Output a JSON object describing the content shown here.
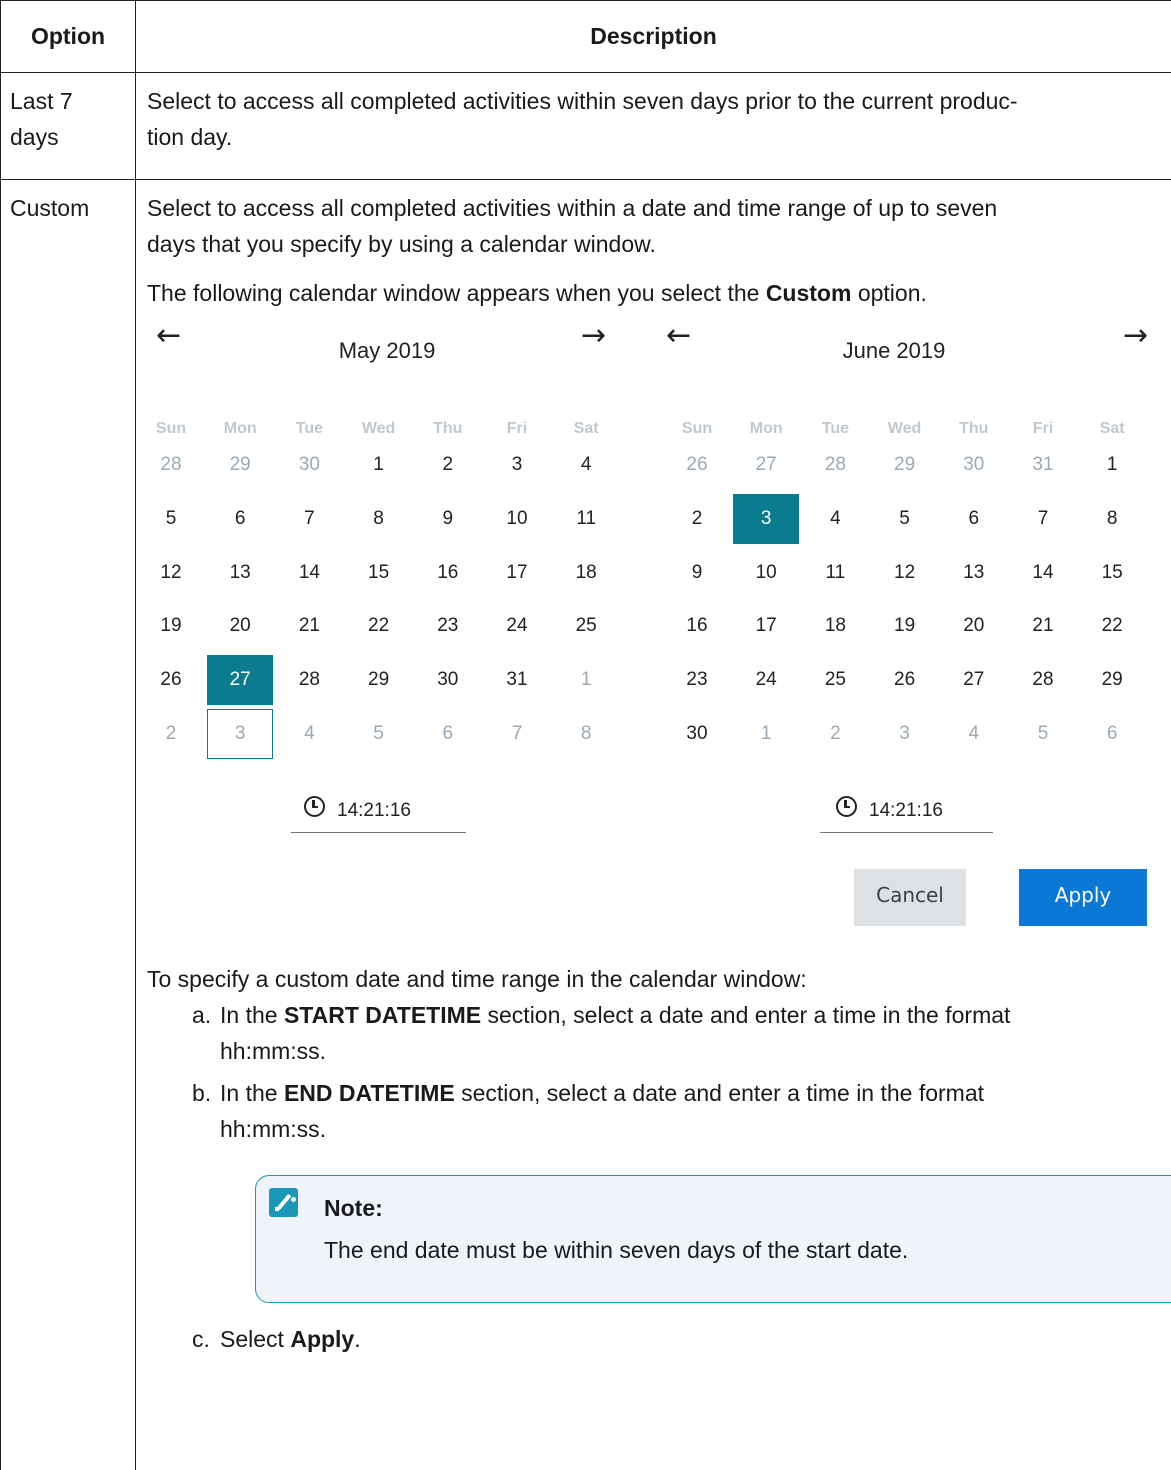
{
  "table": {
    "headers": {
      "option": "Option",
      "description": "Description"
    },
    "rows": {
      "last7": {
        "option_line1": "Last 7",
        "option_line2": "days",
        "description": "Select to access all completed activities within seven days prior to the current produc-",
        "description_cont": "tion day."
      },
      "custom": {
        "option": "Custom",
        "intro_line1": "Select to access all completed activities within a date and time range of up to seven",
        "intro_line2": "days that you specify by using a calendar window.",
        "calendar_intro_pre": "The following calendar window appears when you select the ",
        "calendar_intro_bold": "Custom",
        "calendar_intro_post": " option."
      }
    }
  },
  "calendar": {
    "prev_arrow": "←",
    "next_arrow": "→",
    "weekdays": [
      "Sun",
      "Mon",
      "Tue",
      "Wed",
      "Thu",
      "Fri",
      "Sat"
    ],
    "start": {
      "title": "May 2019",
      "time": "14:21:16",
      "weeks": [
        [
          "28",
          "29",
          "30",
          "1",
          "2",
          "3",
          "4"
        ],
        [
          "5",
          "6",
          "7",
          "8",
          "9",
          "10",
          "11"
        ],
        [
          "12",
          "13",
          "14",
          "15",
          "16",
          "17",
          "18"
        ],
        [
          "19",
          "20",
          "21",
          "22",
          "23",
          "24",
          "25"
        ],
        [
          "26",
          "27",
          "28",
          "29",
          "30",
          "31",
          "1"
        ],
        [
          "2",
          "3",
          "4",
          "5",
          "6",
          "7",
          "8"
        ]
      ],
      "selected_day": "27",
      "today_outline": "3"
    },
    "end": {
      "title": "June 2019",
      "time": "14:21:16",
      "weeks": [
        [
          "26",
          "27",
          "28",
          "29",
          "30",
          "31",
          "1"
        ],
        [
          "2",
          "3",
          "4",
          "5",
          "6",
          "7",
          "8"
        ],
        [
          "9",
          "10",
          "11",
          "12",
          "13",
          "14",
          "15"
        ],
        [
          "16",
          "17",
          "18",
          "19",
          "20",
          "21",
          "22"
        ],
        [
          "23",
          "24",
          "25",
          "26",
          "27",
          "28",
          "29"
        ],
        [
          "30",
          "1",
          "2",
          "3",
          "4",
          "5",
          "6"
        ]
      ],
      "selected_day": "3"
    },
    "buttons": {
      "cancel": "Cancel",
      "apply": "Apply"
    },
    "colors": {
      "selected": "#0b7b8f",
      "apply": "#0a78d4",
      "cancel": "#dde1e4"
    }
  },
  "instructions": {
    "intro": "To specify a custom date and time range in the calendar window:",
    "steps": {
      "a": {
        "label": "a.",
        "pre": "In the ",
        "bold": "START DATETIME",
        "post": " section, select a date and enter a time in the format",
        "cont": "hh:mm:ss."
      },
      "b": {
        "label": "b.",
        "pre": "In the ",
        "bold": "END DATETIME",
        "post": " section, select a date and enter a time in the format",
        "cont": "hh:mm:ss."
      },
      "c": {
        "label": "c.",
        "pre": "Select ",
        "bold": "Apply",
        "post": "."
      }
    },
    "note": {
      "title": "Note:",
      "text": "The end date must be within seven days of the start date."
    }
  }
}
